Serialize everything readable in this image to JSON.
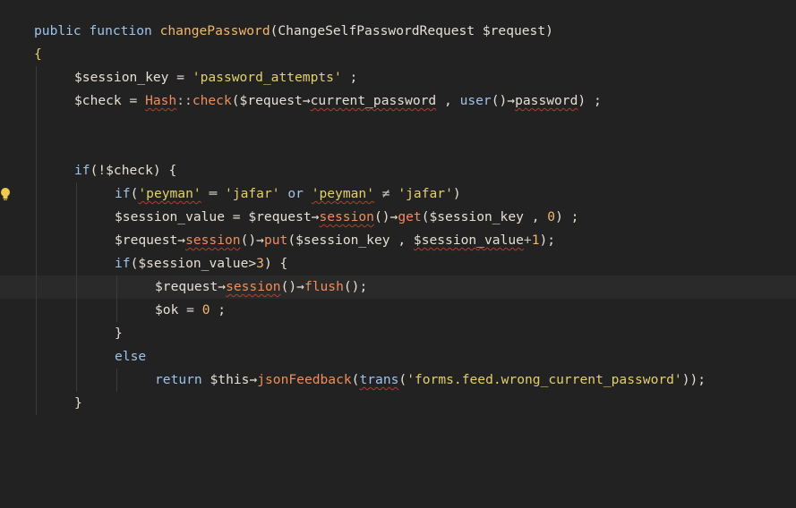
{
  "editor": {
    "theme_colors": {
      "background": "#222222",
      "current_line": "#2a2a2a",
      "keyword": "#9ec3ea",
      "function": "#f2b76a",
      "string": "#e3d06a",
      "error_underline": "#c0392b"
    },
    "gutter_icons": [
      "lightbulb-icon"
    ]
  },
  "code": {
    "l1": {
      "kw": "public function ",
      "fn": "changePassword",
      "rest": "(ChangeSelfPasswordRequest $request)"
    },
    "l2": {
      "text": "{"
    },
    "l3": {
      "var": "$session_key = ",
      "str": "'password_attempts'",
      "tail": " ;"
    },
    "l4": {
      "a": "$check = ",
      "cls": "Hash",
      "sep": "::",
      "call": "check",
      "b": "($request→",
      "prop1": "current_password",
      "c": " , ",
      "usr": "user",
      "d": "()→",
      "prop2": "password",
      "e": ") ;"
    },
    "l7": {
      "kw": "if",
      "rest": "(!$check) {"
    },
    "l8": {
      "kw": "if",
      "a": "(",
      "s1": "'peyman'",
      "op1": " ═ ",
      "s2": "'jafar'",
      "or": " or ",
      "s3": "'peyman'",
      "op2": " ≠ ",
      "s4": "'jafar'",
      "b": ")"
    },
    "l9": {
      "a": "$session_value = $request→",
      "m1": "session",
      "b": "()→",
      "m2": "get",
      "c": "($session_key , ",
      "num": "0",
      "d": ") ;"
    },
    "l10": {
      "a": "$request→",
      "m1": "session",
      "b": "()→",
      "m2": "put",
      "c": "($session_key , ",
      "v": "$session_value",
      "op": "+",
      "num": "1",
      "d": ");"
    },
    "l11": {
      "kw": "if",
      "a": "($session_value>",
      "num": "3",
      "b": ") {"
    },
    "l12": {
      "a": "$request→",
      "m1": "session",
      "b": "()→",
      "m2": "flush",
      "c": "();"
    },
    "l13": {
      "a": "$ok = ",
      "num": "0",
      "b": " ;"
    },
    "l14": {
      "text": "}"
    },
    "l15": {
      "kw": "else"
    },
    "l16": {
      "kw": "return ",
      "a": "$this→",
      "m1": "jsonFeedback",
      "b": "(",
      "m2": "trans",
      "c": "(",
      "str": "'forms.feed.wrong_current_password'",
      "d": "));"
    },
    "l17": {
      "text": "}"
    }
  }
}
